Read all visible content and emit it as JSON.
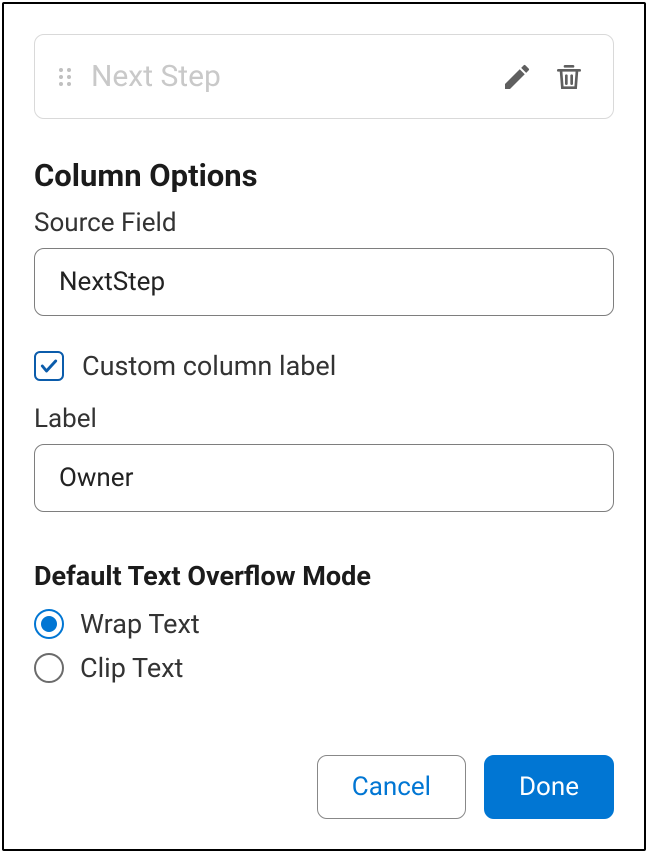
{
  "field_card": {
    "title": "Next Step"
  },
  "column_options": {
    "heading": "Column Options",
    "source_field_label": "Source Field",
    "source_field_value": "NextStep",
    "custom_label_checkbox": "Custom column label",
    "custom_label_checked": true,
    "label_label": "Label",
    "label_value": "Owner"
  },
  "overflow": {
    "heading": "Default Text Overflow Mode",
    "options": [
      {
        "label": "Wrap Text",
        "selected": true
      },
      {
        "label": "Clip Text",
        "selected": false
      }
    ]
  },
  "buttons": {
    "cancel": "Cancel",
    "done": "Done"
  }
}
